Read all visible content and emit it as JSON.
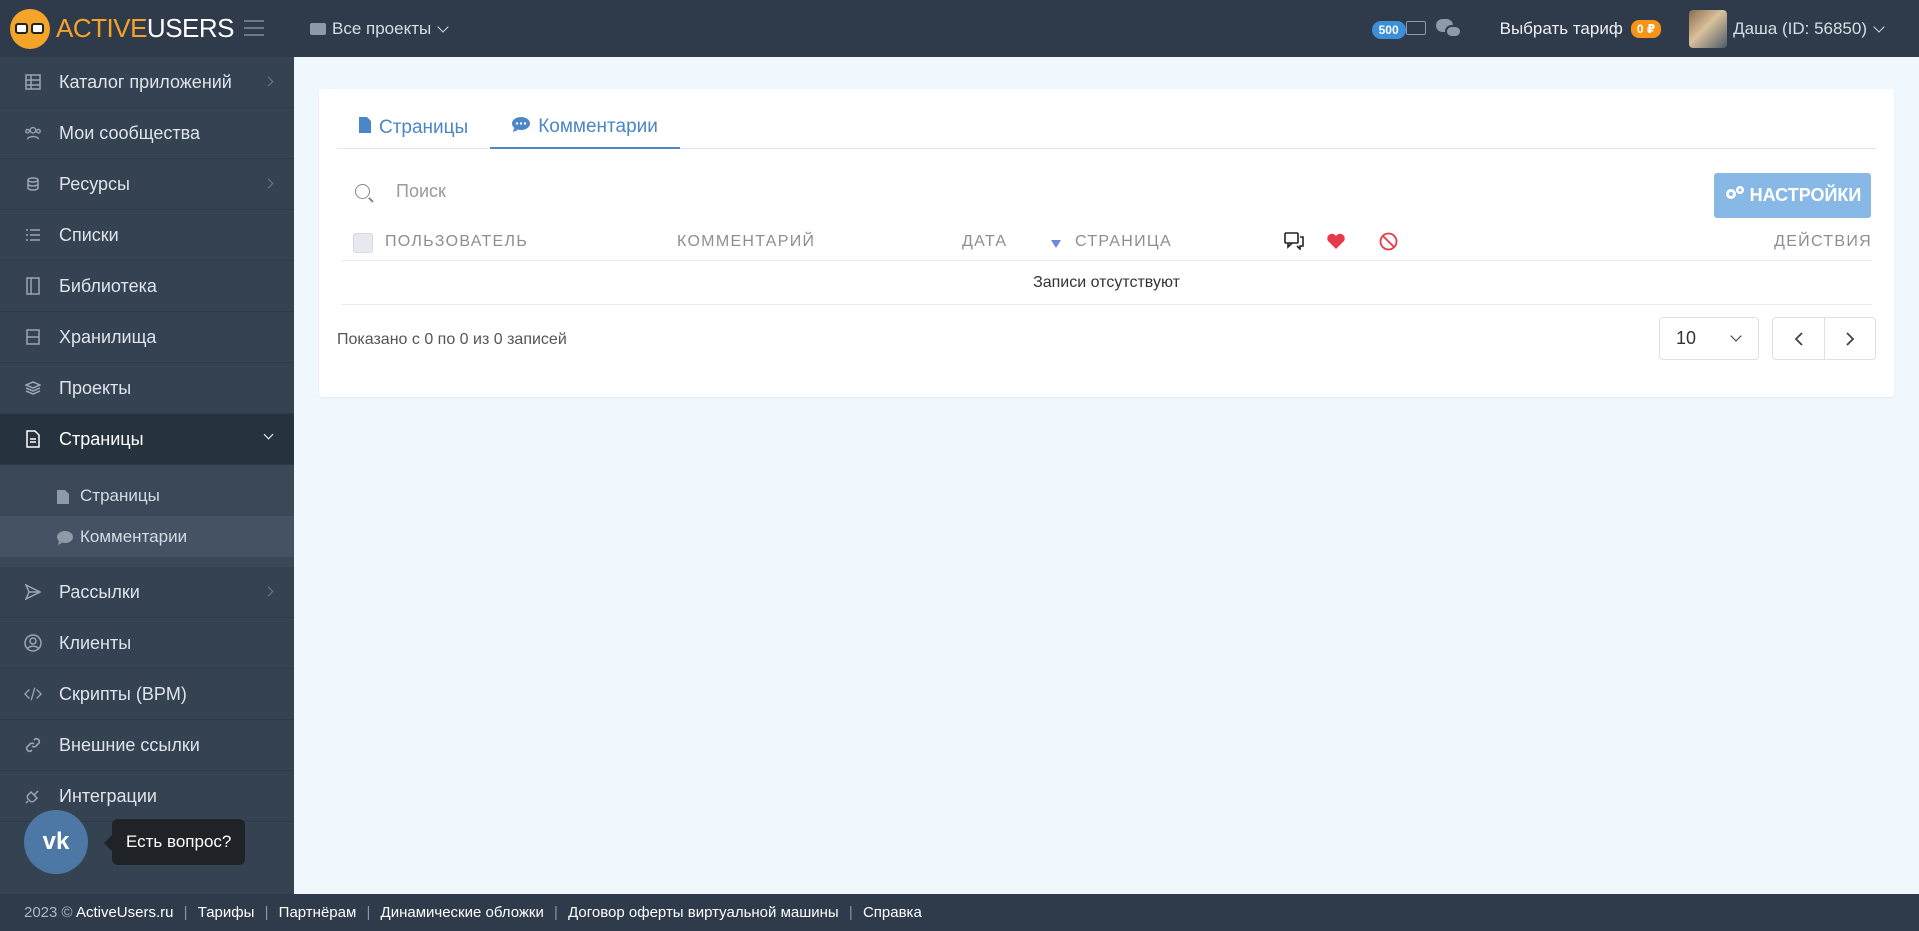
{
  "brand": {
    "logo_part1": "ACTIVE",
    "logo_part2": "USERS"
  },
  "topbar": {
    "projects_label": "Все проекты",
    "keys_badge": "500",
    "tariff_label": "Выбрать тариф",
    "balance": "0 ₽",
    "user_label": "Даша (ID: 56850)"
  },
  "sidebar": {
    "items": [
      {
        "label": "Каталог приложений",
        "icon": "grid-icon"
      },
      {
        "label": "Мои сообщества",
        "icon": "users-icon"
      },
      {
        "label": "Ресурсы",
        "icon": "coins-icon"
      },
      {
        "label": "Списки",
        "icon": "list-icon"
      },
      {
        "label": "Библиотека",
        "icon": "book-icon"
      },
      {
        "label": "Хранилища",
        "icon": "storage-icon"
      },
      {
        "label": "Проекты",
        "icon": "layers-icon"
      },
      {
        "label": "Страницы",
        "icon": "document-icon"
      }
    ],
    "sub_items": [
      {
        "label": "Страницы",
        "icon": "file-icon"
      },
      {
        "label": "Комментарии",
        "icon": "comment-icon"
      }
    ],
    "items_after": [
      {
        "label": "Рассылки",
        "icon": "send-icon"
      },
      {
        "label": "Клиенты",
        "icon": "user-circle-icon"
      },
      {
        "label": "Скрипты (BPM)",
        "icon": "code-icon"
      },
      {
        "label": "Внешние ссылки",
        "icon": "link-icon"
      },
      {
        "label": "Интеграции",
        "icon": "plug-icon"
      }
    ],
    "vk_logo": "vk",
    "help_tooltip": "Есть вопрос?"
  },
  "tabs": [
    {
      "label": "Страницы",
      "icon": "file-icon"
    },
    {
      "label": "Комментарии",
      "icon": "comment-icon"
    }
  ],
  "search": {
    "placeholder": "Поиск"
  },
  "settings_button": "НАСТРОЙКИ",
  "table": {
    "columns": [
      "Пользователь",
      "Комментарий",
      "Дата",
      "Страница",
      "Действия"
    ],
    "empty_text": "Записи отсутствуют"
  },
  "pagination": {
    "summary": "Показано с 0 по 0 из 0 записей",
    "page_size": "10",
    "prev": "‹",
    "next": "›"
  },
  "footer": {
    "copyright": "2023 ©",
    "links": [
      "ActiveUsers.ru",
      "Тарифы",
      "Партнёрам",
      "Динамические обложки",
      "Договор оферты виртуальной машины",
      "Справка"
    ]
  },
  "colors": {
    "accent": "#4a86c8",
    "sidebar": "#354252",
    "topbar": "#2f3b4a",
    "orange": "#f59416",
    "like": "#e6394a"
  }
}
